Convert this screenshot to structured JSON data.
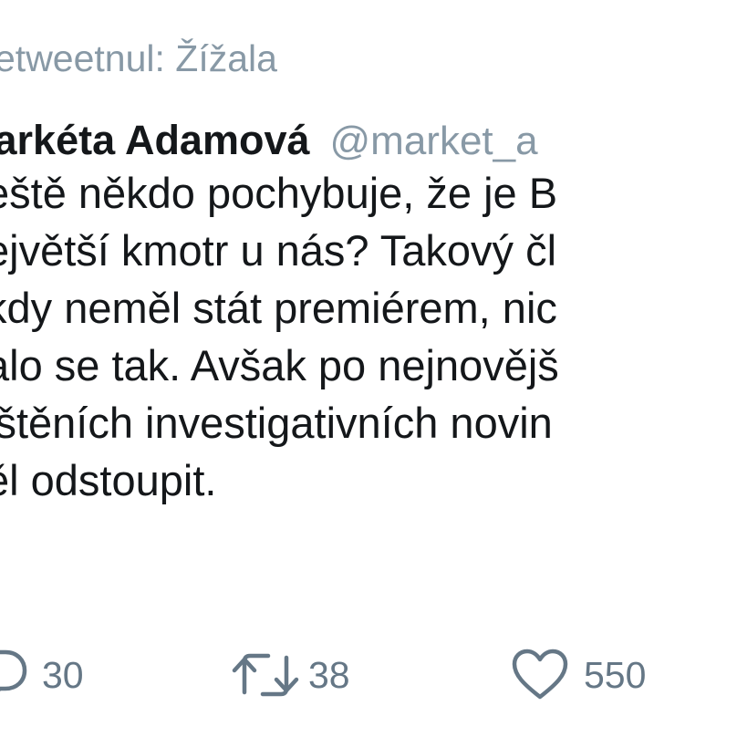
{
  "retweet_context": {
    "text": "etweetnul: Žížala"
  },
  "author": {
    "display_name": "larkéta Adamová",
    "handle": "@market_a"
  },
  "tweet": {
    "lines": [
      "eště někdo pochybuje, že je B",
      "ejvětší kmotr u nás? Takový čl",
      "kdy neměl stát premiérem, nic",
      "alo se tak. Avšak po nejnovějš",
      "ištěních investigativních novin",
      "ěl odstoupit."
    ]
  },
  "actions": {
    "reply": {
      "icon": "reply-icon",
      "count": "30"
    },
    "retweet": {
      "icon": "retweet-icon",
      "count": "38"
    },
    "like": {
      "icon": "heart-icon",
      "count": "550"
    }
  },
  "colors": {
    "text": "#14171a",
    "secondary": "#8899a6",
    "icon": "#657786"
  }
}
